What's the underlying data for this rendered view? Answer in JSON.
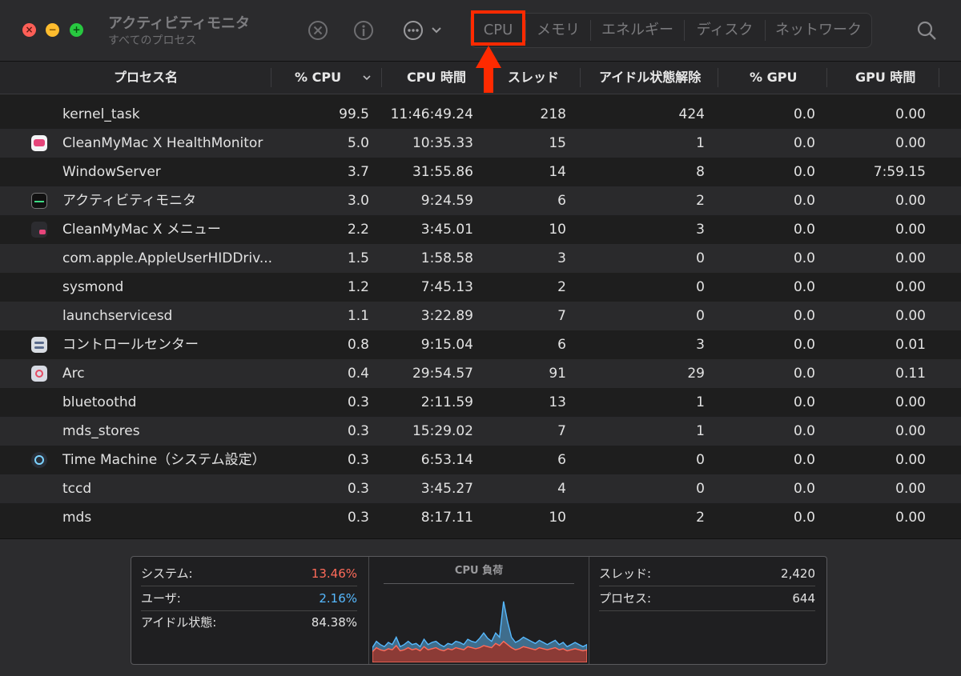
{
  "window": {
    "title": "アクティビティモニタ",
    "subtitle": "すべてのプロセス"
  },
  "toolbar": {
    "close_glyph": "×",
    "minimize_glyph": "−",
    "zoom_glyph": "+",
    "tabs": [
      "CPU",
      "メモリ",
      "エネルギー",
      "ディスク",
      "ネットワーク"
    ],
    "selected_tab": "CPU",
    "highlight_color": "#ff2a00"
  },
  "columns": {
    "process_name": "プロセス名",
    "cpu_percent": "% CPU",
    "cpu_time": "CPU 時間",
    "threads": "スレッド",
    "idle_wakeups": "アイドル状態解除",
    "gpu_percent": "% GPU",
    "gpu_time": "GPU 時間"
  },
  "processes": [
    {
      "name": "kernel_task",
      "icon": "none",
      "cpu": "99.5",
      "cpu_time": "11:46:49.24",
      "threads": "218",
      "idle": "424",
      "gpu": "0.0",
      "gpu_time": "0.00"
    },
    {
      "name": "CleanMyMac X HealthMonitor",
      "icon": "healthmonitor-icon",
      "cpu": "5.0",
      "cpu_time": "10:35.33",
      "threads": "15",
      "idle": "1",
      "gpu": "0.0",
      "gpu_time": "0.00"
    },
    {
      "name": "WindowServer",
      "icon": "none",
      "cpu": "3.7",
      "cpu_time": "31:55.86",
      "threads": "14",
      "idle": "8",
      "gpu": "0.0",
      "gpu_time": "7:59.15"
    },
    {
      "name": "アクティビティモニタ",
      "icon": "activity-monitor-icon",
      "cpu": "3.0",
      "cpu_time": "9:24.59",
      "threads": "6",
      "idle": "2",
      "gpu": "0.0",
      "gpu_time": "0.00"
    },
    {
      "name": "CleanMyMac X メニュー",
      "icon": "cleanmymac-menu-icon",
      "cpu": "2.2",
      "cpu_time": "3:45.01",
      "threads": "10",
      "idle": "3",
      "gpu": "0.0",
      "gpu_time": "0.00"
    },
    {
      "name": "com.apple.AppleUserHIDDriv...",
      "icon": "none",
      "cpu": "1.5",
      "cpu_time": "1:58.58",
      "threads": "3",
      "idle": "0",
      "gpu": "0.0",
      "gpu_time": "0.00"
    },
    {
      "name": "sysmond",
      "icon": "none",
      "cpu": "1.2",
      "cpu_time": "7:45.13",
      "threads": "2",
      "idle": "0",
      "gpu": "0.0",
      "gpu_time": "0.00"
    },
    {
      "name": "launchservicesd",
      "icon": "none",
      "cpu": "1.1",
      "cpu_time": "3:22.89",
      "threads": "7",
      "idle": "0",
      "gpu": "0.0",
      "gpu_time": "0.00"
    },
    {
      "name": "コントロールセンター",
      "icon": "control-center-icon",
      "cpu": "0.8",
      "cpu_time": "9:15.04",
      "threads": "6",
      "idle": "3",
      "gpu": "0.0",
      "gpu_time": "0.01"
    },
    {
      "name": "Arc",
      "icon": "arc-browser-icon",
      "cpu": "0.4",
      "cpu_time": "29:54.57",
      "threads": "91",
      "idle": "29",
      "gpu": "0.0",
      "gpu_time": "0.11"
    },
    {
      "name": "bluetoothd",
      "icon": "none",
      "cpu": "0.3",
      "cpu_time": "2:11.59",
      "threads": "13",
      "idle": "1",
      "gpu": "0.0",
      "gpu_time": "0.00"
    },
    {
      "name": "mds_stores",
      "icon": "none",
      "cpu": "0.3",
      "cpu_time": "15:29.02",
      "threads": "7",
      "idle": "1",
      "gpu": "0.0",
      "gpu_time": "0.00"
    },
    {
      "name": "Time Machine（システム設定）",
      "icon": "time-machine-icon",
      "cpu": "0.3",
      "cpu_time": "6:53.14",
      "threads": "6",
      "idle": "0",
      "gpu": "0.0",
      "gpu_time": "0.00"
    },
    {
      "name": "tccd",
      "icon": "none",
      "cpu": "0.3",
      "cpu_time": "3:45.27",
      "threads": "4",
      "idle": "0",
      "gpu": "0.0",
      "gpu_time": "0.00"
    },
    {
      "name": "mds",
      "icon": "none",
      "cpu": "0.3",
      "cpu_time": "8:17.11",
      "threads": "10",
      "idle": "2",
      "gpu": "0.0",
      "gpu_time": "0.00"
    }
  ],
  "summary": {
    "system_label": "システム:",
    "system_value": "13.46%",
    "user_label": "ユーザ:",
    "user_value": "2.16%",
    "idle_label": "アイドル状態:",
    "idle_value": "84.38%",
    "graph_title": "CPU 負荷",
    "threads_label": "スレッド:",
    "threads_value": "2,420",
    "processes_label": "プロセス:",
    "processes_value": "644",
    "system_color": "#ff6b5a",
    "user_color": "#56b9ff"
  },
  "cpu_load_graph": {
    "system": [
      10,
      14,
      12,
      11,
      13,
      12,
      16,
      11,
      12,
      14,
      12,
      13,
      11,
      15,
      12,
      13,
      14,
      12,
      11,
      13,
      12,
      14,
      13,
      12,
      15,
      14,
      13,
      14,
      16,
      15,
      14,
      18,
      16,
      20,
      17,
      14,
      12,
      13,
      15,
      14,
      13,
      12,
      14,
      13,
      12,
      13,
      14,
      12,
      13,
      11,
      12,
      13,
      12,
      11,
      12
    ],
    "user": [
      4,
      6,
      5,
      4,
      6,
      5,
      8,
      4,
      5,
      6,
      5,
      5,
      4,
      7,
      5,
      6,
      6,
      5,
      4,
      5,
      5,
      6,
      6,
      5,
      7,
      6,
      6,
      9,
      12,
      8,
      6,
      10,
      8,
      38,
      22,
      10,
      7,
      8,
      9,
      8,
      7,
      6,
      7,
      6,
      5,
      6,
      7,
      5,
      6,
      4,
      5,
      6,
      5,
      4,
      5
    ]
  }
}
